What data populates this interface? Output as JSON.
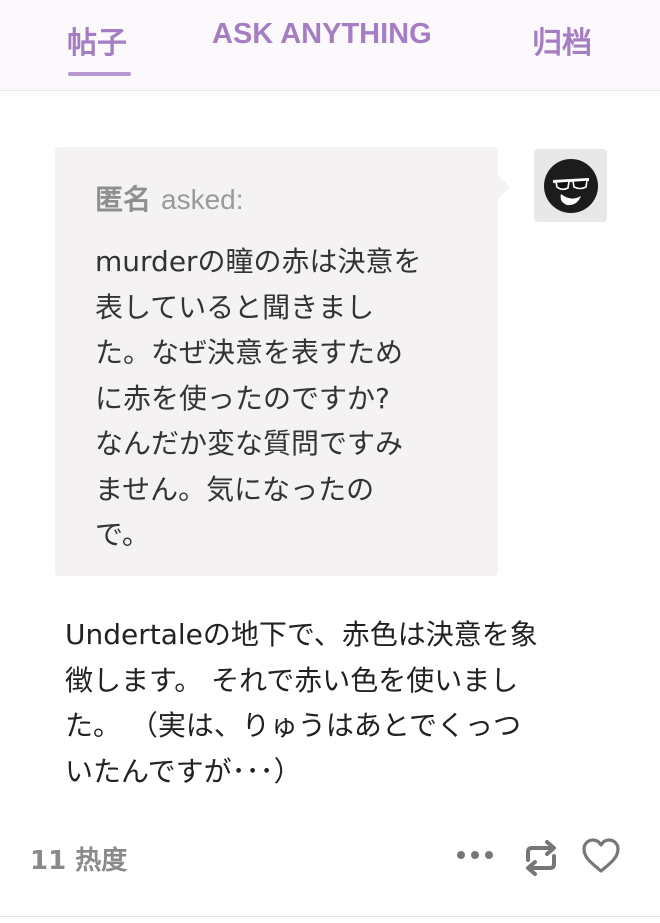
{
  "nav": {
    "tabs": [
      {
        "label": "帖子",
        "active": true
      },
      {
        "label": "ASK ANYTHING",
        "active": false
      },
      {
        "label": "归档",
        "active": false
      }
    ],
    "accent_color": "#a57dc2"
  },
  "ask": {
    "asker_name": "匿名",
    "asked_label": "asked:",
    "question": "murderの瞳の赤は決意を\n表していると聞きまし\nた。なぜ決意を表すため\nに赤を使ったのですか?\nなんだか変な質問ですみ\nません。気になったの\nで。",
    "avatar_icon": "sunglasses-face-icon"
  },
  "answer": {
    "text": "Undertaleの地下で、赤色は決意を象\n徴します。 それで赤い色を使いまし\nた。 （実は、りゅうはあとでくっつ\nいたんですが･･･）"
  },
  "footer": {
    "notes_label": "11 热度",
    "icons": [
      "more-icon",
      "reblog-icon",
      "like-icon"
    ]
  }
}
